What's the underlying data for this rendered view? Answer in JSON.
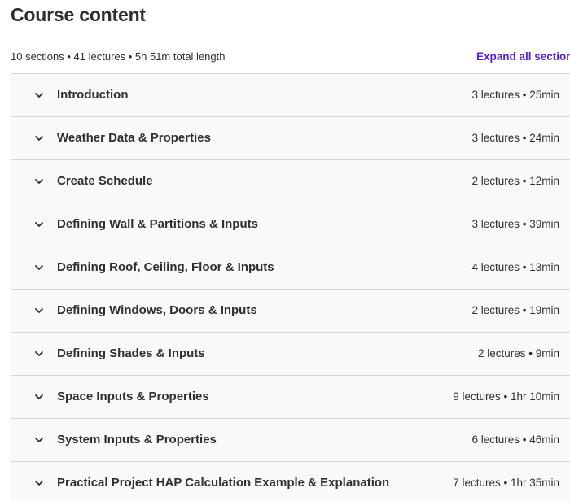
{
  "header": {
    "title": "Course content",
    "summary": "10 sections • 41 lectures • 5h 51m total length",
    "expand_all_label": "Expand all sections"
  },
  "sections": [
    {
      "title": "Introduction",
      "meta": "3 lectures • 25min"
    },
    {
      "title": "Weather Data & Properties",
      "meta": "3 lectures • 24min"
    },
    {
      "title": "Create Schedule",
      "meta": "2 lectures • 12min"
    },
    {
      "title": "Defining Wall & Partitions & Inputs",
      "meta": "3 lectures • 39min"
    },
    {
      "title": "Defining Roof, Ceiling, Floor & Inputs",
      "meta": "4 lectures • 13min"
    },
    {
      "title": "Defining Windows, Doors & Inputs",
      "meta": "2 lectures • 19min"
    },
    {
      "title": "Defining Shades & Inputs",
      "meta": "2 lectures • 9min"
    },
    {
      "title": "Space Inputs & Properties",
      "meta": "9 lectures • 1hr 10min"
    },
    {
      "title": "System Inputs & Properties",
      "meta": "6 lectures • 46min"
    },
    {
      "title": "Practical Project HAP Calculation Example & Explanation",
      "meta": "7 lectures • 1hr 35min"
    }
  ],
  "icons": {
    "section_toggle": "chevron-down-icon"
  },
  "colors": {
    "accent": "#5624d0",
    "section_bg": "#f7f9fa",
    "border": "#d1d7dc",
    "text": "#2d2f31"
  }
}
